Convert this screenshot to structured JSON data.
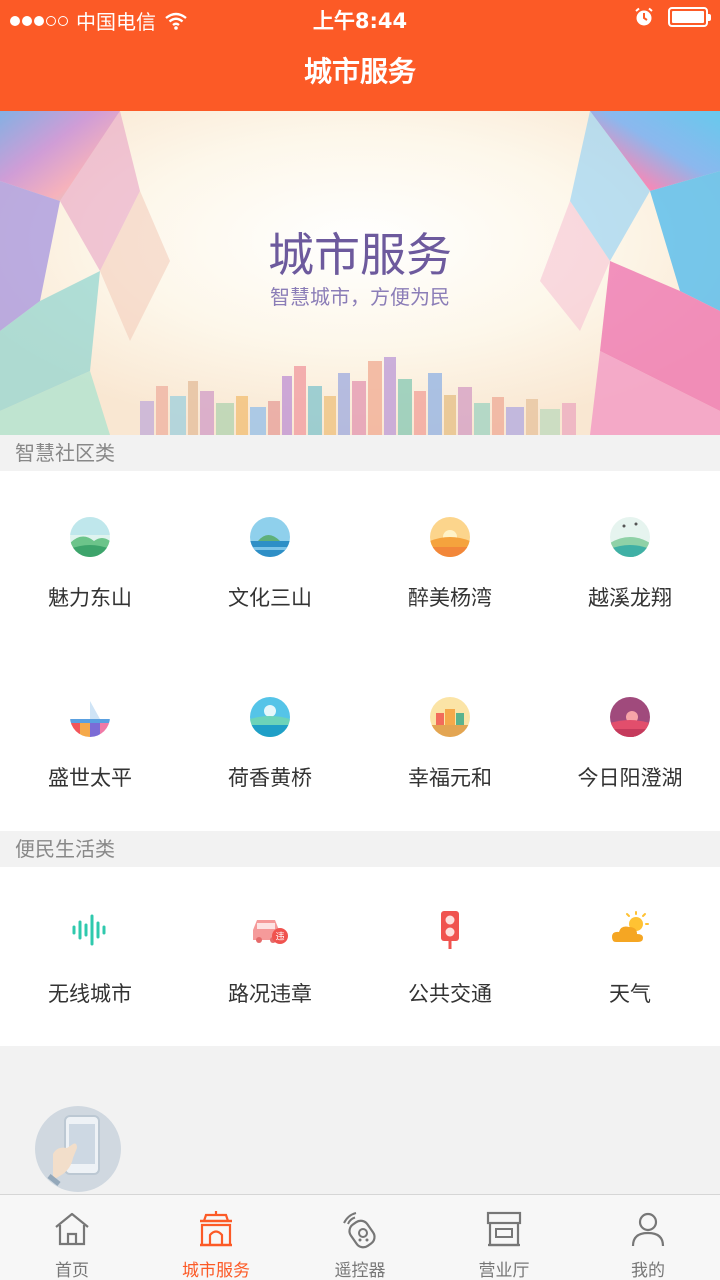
{
  "status_bar": {
    "carrier": "中国电信",
    "time": "上午8:44"
  },
  "nav": {
    "title": "城市服务"
  },
  "banner": {
    "title": "城市服务",
    "subtitle": "智慧城市，方便为民"
  },
  "sections": [
    {
      "title": "智慧社区类",
      "items": [
        {
          "label": "魅力东山",
          "icon": "landscape-hills-icon"
        },
        {
          "label": "文化三山",
          "icon": "landscape-island-icon"
        },
        {
          "label": "醉美杨湾",
          "icon": "landscape-sunset-icon"
        },
        {
          "label": "越溪龙翔",
          "icon": "landscape-bridge-icon"
        },
        {
          "label": "盛世太平",
          "icon": "landscape-sailboat-icon"
        },
        {
          "label": "荷香黄桥",
          "icon": "landscape-lake-icon"
        },
        {
          "label": "幸福元和",
          "icon": "landscape-town-icon"
        },
        {
          "label": "今日阳澄湖",
          "icon": "landscape-dusk-icon"
        }
      ]
    },
    {
      "title": "便民生活类",
      "items": [
        {
          "label": "无线城市",
          "icon": "wifi-wave-icon"
        },
        {
          "label": "路况违章",
          "icon": "car-violation-icon"
        },
        {
          "label": "公共交通",
          "icon": "traffic-light-icon"
        },
        {
          "label": "天气",
          "icon": "weather-icon"
        }
      ]
    }
  ],
  "tabbar": {
    "items": [
      {
        "label": "首页",
        "icon": "home-icon",
        "active": false
      },
      {
        "label": "城市服务",
        "icon": "city-gate-icon",
        "active": true
      },
      {
        "label": "遥控器",
        "icon": "remote-control-icon",
        "active": false
      },
      {
        "label": "营业厅",
        "icon": "store-icon",
        "active": false
      },
      {
        "label": "我的",
        "icon": "user-icon",
        "active": false
      }
    ]
  },
  "colors": {
    "brand": "#fc5a26",
    "active_tab": "#fc5a26"
  }
}
